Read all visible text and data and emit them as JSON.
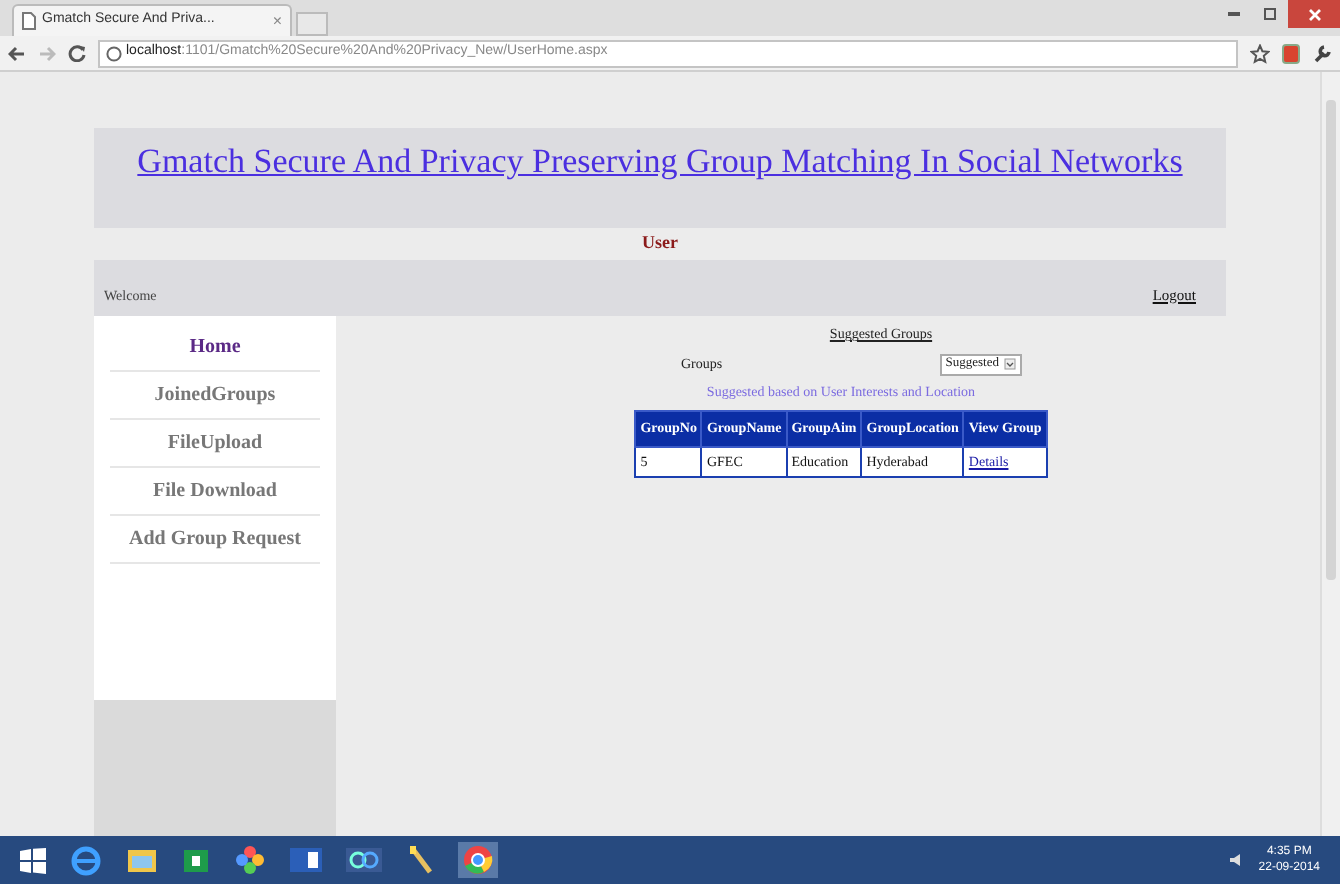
{
  "browser": {
    "tab_title": "Gmatch Secure And Priva...",
    "tab_close": "×",
    "url_host": "localhost",
    "url_path": ":1101/Gmatch%20Secure%20And%20Privacy_New/UserHome.aspx"
  },
  "header": {
    "title": "Gmatch Secure And Privacy Preserving Group Matching In Social Networks"
  },
  "role_label": "User",
  "welcome_bar": {
    "welcome": "Welcome",
    "logout": "Logout"
  },
  "sidebar": {
    "items": [
      {
        "label": "Home",
        "selected": true
      },
      {
        "label": "JoinedGroups",
        "selected": false
      },
      {
        "label": "FileUpload",
        "selected": false
      },
      {
        "label": "File Download",
        "selected": false
      },
      {
        "label": "Add Group Request",
        "selected": false
      }
    ]
  },
  "content": {
    "heading": "Suggested Groups",
    "groups_label": "Groups",
    "groups_select": "Suggested",
    "caption": "Suggested based on User Interests and Location",
    "table": {
      "columns": [
        "GroupNo",
        "GroupName",
        "GroupAim",
        "GroupLocation",
        "View Group"
      ],
      "rows": [
        [
          "5",
          "GFEC",
          "Education",
          "Hyderabad",
          "Details"
        ]
      ]
    }
  },
  "taskbar": {
    "time": "4:35 PM",
    "date": "22-09-2014"
  }
}
